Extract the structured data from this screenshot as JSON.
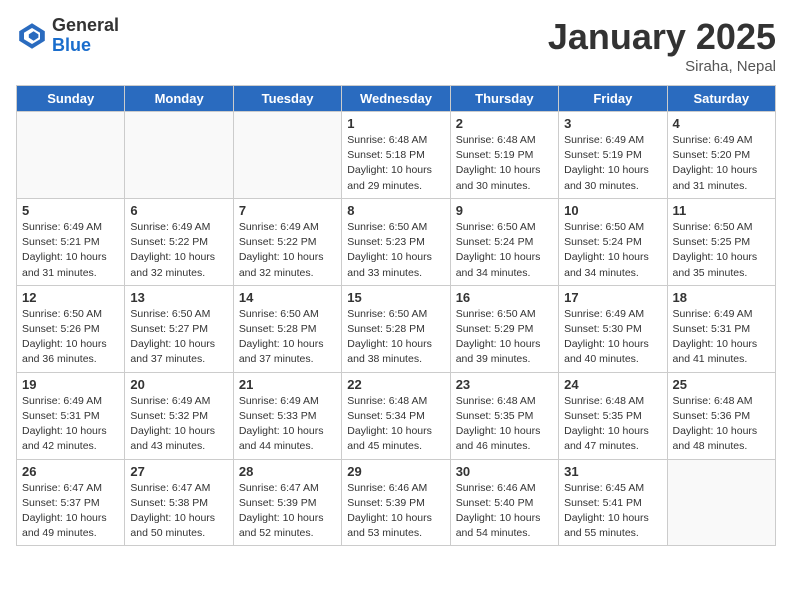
{
  "header": {
    "logo_general": "General",
    "logo_blue": "Blue",
    "month_title": "January 2025",
    "location": "Siraha, Nepal"
  },
  "days_of_week": [
    "Sunday",
    "Monday",
    "Tuesday",
    "Wednesday",
    "Thursday",
    "Friday",
    "Saturday"
  ],
  "weeks": [
    [
      {
        "day": "",
        "detail": ""
      },
      {
        "day": "",
        "detail": ""
      },
      {
        "day": "",
        "detail": ""
      },
      {
        "day": "1",
        "detail": "Sunrise: 6:48 AM\nSunset: 5:18 PM\nDaylight: 10 hours\nand 29 minutes."
      },
      {
        "day": "2",
        "detail": "Sunrise: 6:48 AM\nSunset: 5:19 PM\nDaylight: 10 hours\nand 30 minutes."
      },
      {
        "day": "3",
        "detail": "Sunrise: 6:49 AM\nSunset: 5:19 PM\nDaylight: 10 hours\nand 30 minutes."
      },
      {
        "day": "4",
        "detail": "Sunrise: 6:49 AM\nSunset: 5:20 PM\nDaylight: 10 hours\nand 31 minutes."
      }
    ],
    [
      {
        "day": "5",
        "detail": "Sunrise: 6:49 AM\nSunset: 5:21 PM\nDaylight: 10 hours\nand 31 minutes."
      },
      {
        "day": "6",
        "detail": "Sunrise: 6:49 AM\nSunset: 5:22 PM\nDaylight: 10 hours\nand 32 minutes."
      },
      {
        "day": "7",
        "detail": "Sunrise: 6:49 AM\nSunset: 5:22 PM\nDaylight: 10 hours\nand 32 minutes."
      },
      {
        "day": "8",
        "detail": "Sunrise: 6:50 AM\nSunset: 5:23 PM\nDaylight: 10 hours\nand 33 minutes."
      },
      {
        "day": "9",
        "detail": "Sunrise: 6:50 AM\nSunset: 5:24 PM\nDaylight: 10 hours\nand 34 minutes."
      },
      {
        "day": "10",
        "detail": "Sunrise: 6:50 AM\nSunset: 5:24 PM\nDaylight: 10 hours\nand 34 minutes."
      },
      {
        "day": "11",
        "detail": "Sunrise: 6:50 AM\nSunset: 5:25 PM\nDaylight: 10 hours\nand 35 minutes."
      }
    ],
    [
      {
        "day": "12",
        "detail": "Sunrise: 6:50 AM\nSunset: 5:26 PM\nDaylight: 10 hours\nand 36 minutes."
      },
      {
        "day": "13",
        "detail": "Sunrise: 6:50 AM\nSunset: 5:27 PM\nDaylight: 10 hours\nand 37 minutes."
      },
      {
        "day": "14",
        "detail": "Sunrise: 6:50 AM\nSunset: 5:28 PM\nDaylight: 10 hours\nand 37 minutes."
      },
      {
        "day": "15",
        "detail": "Sunrise: 6:50 AM\nSunset: 5:28 PM\nDaylight: 10 hours\nand 38 minutes."
      },
      {
        "day": "16",
        "detail": "Sunrise: 6:50 AM\nSunset: 5:29 PM\nDaylight: 10 hours\nand 39 minutes."
      },
      {
        "day": "17",
        "detail": "Sunrise: 6:49 AM\nSunset: 5:30 PM\nDaylight: 10 hours\nand 40 minutes."
      },
      {
        "day": "18",
        "detail": "Sunrise: 6:49 AM\nSunset: 5:31 PM\nDaylight: 10 hours\nand 41 minutes."
      }
    ],
    [
      {
        "day": "19",
        "detail": "Sunrise: 6:49 AM\nSunset: 5:31 PM\nDaylight: 10 hours\nand 42 minutes."
      },
      {
        "day": "20",
        "detail": "Sunrise: 6:49 AM\nSunset: 5:32 PM\nDaylight: 10 hours\nand 43 minutes."
      },
      {
        "day": "21",
        "detail": "Sunrise: 6:49 AM\nSunset: 5:33 PM\nDaylight: 10 hours\nand 44 minutes."
      },
      {
        "day": "22",
        "detail": "Sunrise: 6:48 AM\nSunset: 5:34 PM\nDaylight: 10 hours\nand 45 minutes."
      },
      {
        "day": "23",
        "detail": "Sunrise: 6:48 AM\nSunset: 5:35 PM\nDaylight: 10 hours\nand 46 minutes."
      },
      {
        "day": "24",
        "detail": "Sunrise: 6:48 AM\nSunset: 5:35 PM\nDaylight: 10 hours\nand 47 minutes."
      },
      {
        "day": "25",
        "detail": "Sunrise: 6:48 AM\nSunset: 5:36 PM\nDaylight: 10 hours\nand 48 minutes."
      }
    ],
    [
      {
        "day": "26",
        "detail": "Sunrise: 6:47 AM\nSunset: 5:37 PM\nDaylight: 10 hours\nand 49 minutes."
      },
      {
        "day": "27",
        "detail": "Sunrise: 6:47 AM\nSunset: 5:38 PM\nDaylight: 10 hours\nand 50 minutes."
      },
      {
        "day": "28",
        "detail": "Sunrise: 6:47 AM\nSunset: 5:39 PM\nDaylight: 10 hours\nand 52 minutes."
      },
      {
        "day": "29",
        "detail": "Sunrise: 6:46 AM\nSunset: 5:39 PM\nDaylight: 10 hours\nand 53 minutes."
      },
      {
        "day": "30",
        "detail": "Sunrise: 6:46 AM\nSunset: 5:40 PM\nDaylight: 10 hours\nand 54 minutes."
      },
      {
        "day": "31",
        "detail": "Sunrise: 6:45 AM\nSunset: 5:41 PM\nDaylight: 10 hours\nand 55 minutes."
      },
      {
        "day": "",
        "detail": ""
      }
    ]
  ]
}
